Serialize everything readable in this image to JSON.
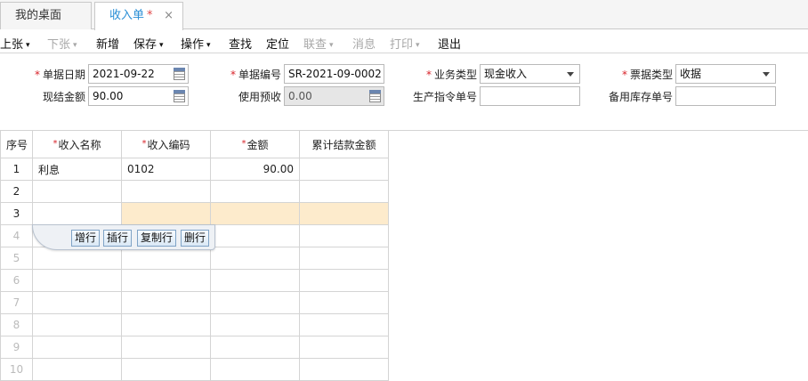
{
  "tabs": {
    "home": "我的桌面",
    "active": "收入单",
    "dirty_mark": "*",
    "close_glyph": "×"
  },
  "toolbar": {
    "prev": "上张",
    "next": "下张",
    "new": "新增",
    "save": "保存",
    "operate": "操作",
    "find": "查找",
    "locate": "定位",
    "review": "联查",
    "message": "消息",
    "print": "打印",
    "exit": "退出",
    "caret": "▾"
  },
  "form": {
    "required_mark": "*",
    "doc_date_label": "单据日期",
    "doc_date_value": "2021-09-22",
    "doc_no_label": "单据编号",
    "doc_no_value": "SR-2021-09-0002",
    "biz_type_label": "业务类型",
    "biz_type_value": "现金收入",
    "bill_type_label": "票据类型",
    "bill_type_value": "收据",
    "cash_amount_label": "现结金额",
    "cash_amount_value": "90.00",
    "prepaid_label": "使用预收",
    "prepaid_value": "0.00",
    "prod_order_label": "生产指令单号",
    "prod_order_value": "",
    "spare_stock_label": "备用库存单号",
    "spare_stock_value": ""
  },
  "grid": {
    "columns": {
      "index": "序号",
      "name": "收入名称",
      "code": "收入编码",
      "amount": "金额",
      "settled": "累计结款金额"
    },
    "rows": [
      {
        "idx": "1",
        "name": "利息",
        "code": "0102",
        "amount": "90.00",
        "settled": ""
      },
      {
        "idx": "2",
        "name": "",
        "code": "",
        "amount": "",
        "settled": ""
      },
      {
        "idx": "3",
        "name": "",
        "code": "",
        "amount": "",
        "settled": ""
      },
      {
        "idx": "4",
        "name": "",
        "code": "",
        "amount": "",
        "settled": ""
      },
      {
        "idx": "5",
        "name": "",
        "code": "",
        "amount": "",
        "settled": ""
      },
      {
        "idx": "6",
        "name": "",
        "code": "",
        "amount": "",
        "settled": ""
      },
      {
        "idx": "7",
        "name": "",
        "code": "",
        "amount": "",
        "settled": ""
      },
      {
        "idx": "8",
        "name": "",
        "code": "",
        "amount": "",
        "settled": ""
      },
      {
        "idx": "9",
        "name": "",
        "code": "",
        "amount": "",
        "settled": ""
      },
      {
        "idx": "10",
        "name": "",
        "code": "",
        "amount": "",
        "settled": ""
      }
    ]
  },
  "row_actions": {
    "add": "增行",
    "insert": "插行",
    "copy": "复制行",
    "delete": "删行"
  },
  "colors": {
    "accent": "#2b8fd6",
    "required": "#d8232a",
    "selected_row": "#fdebcc",
    "readonly_field": "#e6e6e6"
  }
}
